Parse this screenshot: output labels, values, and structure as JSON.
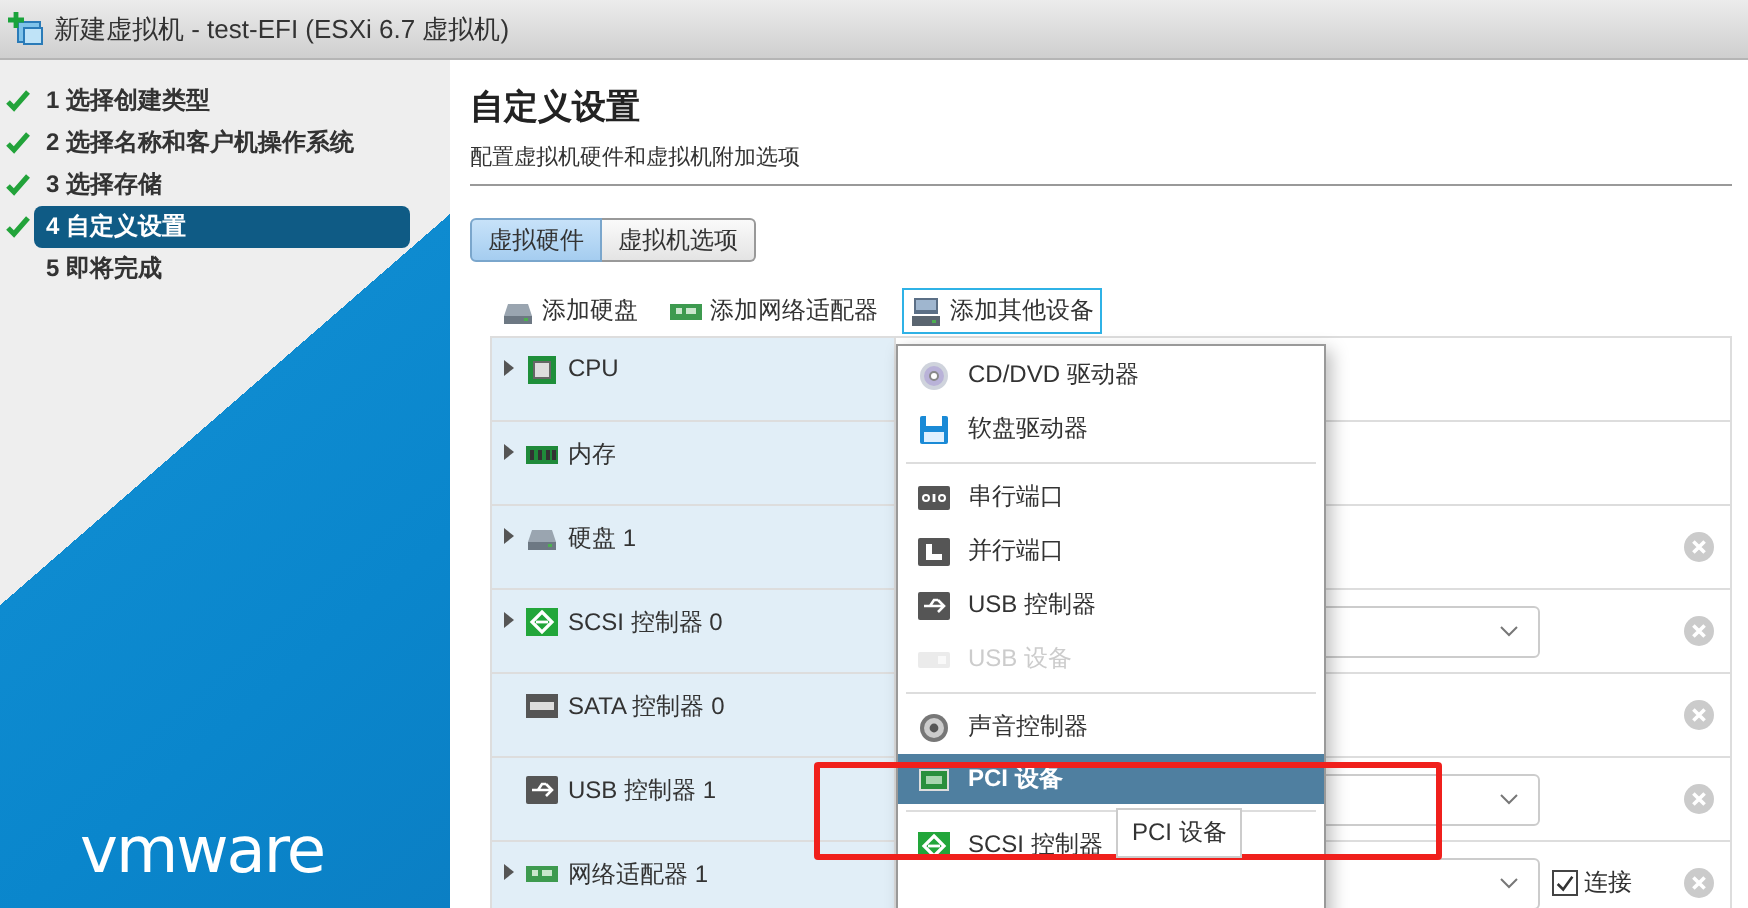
{
  "window": {
    "title": "新建虚拟机 - test-EFI (ESXi 6.7 虚拟机)"
  },
  "sidebar": {
    "steps": [
      {
        "number": "1",
        "label": "选择创建类型",
        "done": true,
        "selected": false
      },
      {
        "number": "2",
        "label": "选择名称和客户机操作系统",
        "done": true,
        "selected": false
      },
      {
        "number": "3",
        "label": "选择存储",
        "done": true,
        "selected": false
      },
      {
        "number": "4",
        "label": "自定义设置",
        "done": true,
        "selected": true
      },
      {
        "number": "5",
        "label": "即将完成",
        "done": false,
        "selected": false
      }
    ],
    "logo": "vmware"
  },
  "page": {
    "title": "自定义设置",
    "subtitle": "配置虚拟机硬件和虚拟机附加选项"
  },
  "tabs": [
    {
      "label": "虚拟硬件",
      "selected": true
    },
    {
      "label": "虚拟机选项",
      "selected": false
    }
  ],
  "toolbar": [
    {
      "label": "添加硬盘",
      "kind": "disk",
      "expanded": false
    },
    {
      "label": "添加网络适配器",
      "kind": "network",
      "expanded": false
    },
    {
      "label": "添加其他设备",
      "kind": "device",
      "expanded": true
    }
  ],
  "hardware": [
    {
      "name": "CPU",
      "kind": "cpu",
      "expandable": true,
      "has_select": false,
      "removable": false
    },
    {
      "name": "内存",
      "kind": "memory",
      "expandable": true,
      "has_select": false,
      "removable": false
    },
    {
      "name": "硬盘 1",
      "kind": "disk",
      "expandable": true,
      "has_select": false,
      "removable": true
    },
    {
      "name": "SCSI 控制器 0",
      "kind": "scsi",
      "expandable": true,
      "has_select": true,
      "removable": true
    },
    {
      "name": "SATA 控制器 0",
      "kind": "sata",
      "expandable": false,
      "has_select": false,
      "removable": true
    },
    {
      "name": "USB 控制器 1",
      "kind": "usb",
      "expandable": false,
      "has_select": true,
      "removable": true
    },
    {
      "name": "网络适配器 1",
      "kind": "network",
      "expandable": true,
      "has_select": true,
      "removable": true,
      "connect": {
        "label": "连接",
        "checked": true
      }
    }
  ],
  "add_menu": [
    {
      "kind": "cdrom",
      "label": "CD/DVD 驱动器",
      "disabled": false,
      "selected": false
    },
    {
      "kind": "floppy",
      "label": "软盘驱动器",
      "disabled": false,
      "selected": false
    },
    {
      "kind": "separator"
    },
    {
      "kind": "serial",
      "label": "串行端口",
      "disabled": false,
      "selected": false
    },
    {
      "kind": "parallel",
      "label": "并行端口",
      "disabled": false,
      "selected": false
    },
    {
      "kind": "usb",
      "label": "USB 控制器",
      "disabled": false,
      "selected": false
    },
    {
      "kind": "usbdev",
      "label": "USB 设备",
      "disabled": true,
      "selected": false
    },
    {
      "kind": "separator"
    },
    {
      "kind": "sound",
      "label": "声音控制器",
      "disabled": false,
      "selected": false
    },
    {
      "kind": "pci",
      "label": "PCI 设备",
      "disabled": false,
      "selected": true
    },
    {
      "kind": "separator"
    },
    {
      "kind": "scsi",
      "label": "SCSI 控制器",
      "disabled": false,
      "selected": false
    }
  ],
  "tooltip": "PCI 设备"
}
